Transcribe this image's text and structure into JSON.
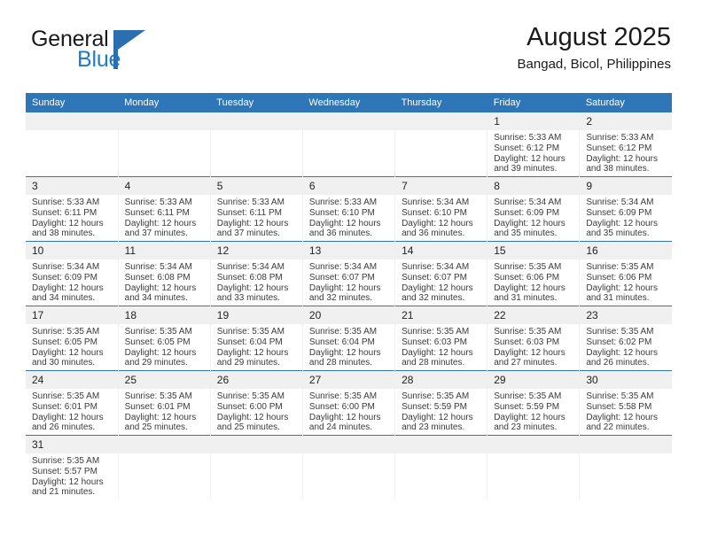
{
  "brand": {
    "word_one": "General",
    "word_two": "Blue",
    "mark_icon": "flag-triangle-icon"
  },
  "header": {
    "title": "August 2025",
    "subtitle": "Bangad, Bicol, Philippines"
  },
  "calendar": {
    "weekday_headers": [
      "Sunday",
      "Monday",
      "Tuesday",
      "Wednesday",
      "Thursday",
      "Friday",
      "Saturday"
    ],
    "accent_color": "#2e76b8",
    "daynum_band_color": "#f0f0f0",
    "weeks": [
      [
        {
          "day": "",
          "sunrise": "",
          "sunset": "",
          "daylight_line1": "",
          "daylight_line2": ""
        },
        {
          "day": "",
          "sunrise": "",
          "sunset": "",
          "daylight_line1": "",
          "daylight_line2": ""
        },
        {
          "day": "",
          "sunrise": "",
          "sunset": "",
          "daylight_line1": "",
          "daylight_line2": ""
        },
        {
          "day": "",
          "sunrise": "",
          "sunset": "",
          "daylight_line1": "",
          "daylight_line2": ""
        },
        {
          "day": "",
          "sunrise": "",
          "sunset": "",
          "daylight_line1": "",
          "daylight_line2": ""
        },
        {
          "day": "1",
          "sunrise": "Sunrise: 5:33 AM",
          "sunset": "Sunset: 6:12 PM",
          "daylight_line1": "Daylight: 12 hours",
          "daylight_line2": "and 39 minutes."
        },
        {
          "day": "2",
          "sunrise": "Sunrise: 5:33 AM",
          "sunset": "Sunset: 6:12 PM",
          "daylight_line1": "Daylight: 12 hours",
          "daylight_line2": "and 38 minutes."
        }
      ],
      [
        {
          "day": "3",
          "sunrise": "Sunrise: 5:33 AM",
          "sunset": "Sunset: 6:11 PM",
          "daylight_line1": "Daylight: 12 hours",
          "daylight_line2": "and 38 minutes."
        },
        {
          "day": "4",
          "sunrise": "Sunrise: 5:33 AM",
          "sunset": "Sunset: 6:11 PM",
          "daylight_line1": "Daylight: 12 hours",
          "daylight_line2": "and 37 minutes."
        },
        {
          "day": "5",
          "sunrise": "Sunrise: 5:33 AM",
          "sunset": "Sunset: 6:11 PM",
          "daylight_line1": "Daylight: 12 hours",
          "daylight_line2": "and 37 minutes."
        },
        {
          "day": "6",
          "sunrise": "Sunrise: 5:33 AM",
          "sunset": "Sunset: 6:10 PM",
          "daylight_line1": "Daylight: 12 hours",
          "daylight_line2": "and 36 minutes."
        },
        {
          "day": "7",
          "sunrise": "Sunrise: 5:34 AM",
          "sunset": "Sunset: 6:10 PM",
          "daylight_line1": "Daylight: 12 hours",
          "daylight_line2": "and 36 minutes."
        },
        {
          "day": "8",
          "sunrise": "Sunrise: 5:34 AM",
          "sunset": "Sunset: 6:09 PM",
          "daylight_line1": "Daylight: 12 hours",
          "daylight_line2": "and 35 minutes."
        },
        {
          "day": "9",
          "sunrise": "Sunrise: 5:34 AM",
          "sunset": "Sunset: 6:09 PM",
          "daylight_line1": "Daylight: 12 hours",
          "daylight_line2": "and 35 minutes."
        }
      ],
      [
        {
          "day": "10",
          "sunrise": "Sunrise: 5:34 AM",
          "sunset": "Sunset: 6:09 PM",
          "daylight_line1": "Daylight: 12 hours",
          "daylight_line2": "and 34 minutes."
        },
        {
          "day": "11",
          "sunrise": "Sunrise: 5:34 AM",
          "sunset": "Sunset: 6:08 PM",
          "daylight_line1": "Daylight: 12 hours",
          "daylight_line2": "and 34 minutes."
        },
        {
          "day": "12",
          "sunrise": "Sunrise: 5:34 AM",
          "sunset": "Sunset: 6:08 PM",
          "daylight_line1": "Daylight: 12 hours",
          "daylight_line2": "and 33 minutes."
        },
        {
          "day": "13",
          "sunrise": "Sunrise: 5:34 AM",
          "sunset": "Sunset: 6:07 PM",
          "daylight_line1": "Daylight: 12 hours",
          "daylight_line2": "and 32 minutes."
        },
        {
          "day": "14",
          "sunrise": "Sunrise: 5:34 AM",
          "sunset": "Sunset: 6:07 PM",
          "daylight_line1": "Daylight: 12 hours",
          "daylight_line2": "and 32 minutes."
        },
        {
          "day": "15",
          "sunrise": "Sunrise: 5:35 AM",
          "sunset": "Sunset: 6:06 PM",
          "daylight_line1": "Daylight: 12 hours",
          "daylight_line2": "and 31 minutes."
        },
        {
          "day": "16",
          "sunrise": "Sunrise: 5:35 AM",
          "sunset": "Sunset: 6:06 PM",
          "daylight_line1": "Daylight: 12 hours",
          "daylight_line2": "and 31 minutes."
        }
      ],
      [
        {
          "day": "17",
          "sunrise": "Sunrise: 5:35 AM",
          "sunset": "Sunset: 6:05 PM",
          "daylight_line1": "Daylight: 12 hours",
          "daylight_line2": "and 30 minutes."
        },
        {
          "day": "18",
          "sunrise": "Sunrise: 5:35 AM",
          "sunset": "Sunset: 6:05 PM",
          "daylight_line1": "Daylight: 12 hours",
          "daylight_line2": "and 29 minutes."
        },
        {
          "day": "19",
          "sunrise": "Sunrise: 5:35 AM",
          "sunset": "Sunset: 6:04 PM",
          "daylight_line1": "Daylight: 12 hours",
          "daylight_line2": "and 29 minutes."
        },
        {
          "day": "20",
          "sunrise": "Sunrise: 5:35 AM",
          "sunset": "Sunset: 6:04 PM",
          "daylight_line1": "Daylight: 12 hours",
          "daylight_line2": "and 28 minutes."
        },
        {
          "day": "21",
          "sunrise": "Sunrise: 5:35 AM",
          "sunset": "Sunset: 6:03 PM",
          "daylight_line1": "Daylight: 12 hours",
          "daylight_line2": "and 28 minutes."
        },
        {
          "day": "22",
          "sunrise": "Sunrise: 5:35 AM",
          "sunset": "Sunset: 6:03 PM",
          "daylight_line1": "Daylight: 12 hours",
          "daylight_line2": "and 27 minutes."
        },
        {
          "day": "23",
          "sunrise": "Sunrise: 5:35 AM",
          "sunset": "Sunset: 6:02 PM",
          "daylight_line1": "Daylight: 12 hours",
          "daylight_line2": "and 26 minutes."
        }
      ],
      [
        {
          "day": "24",
          "sunrise": "Sunrise: 5:35 AM",
          "sunset": "Sunset: 6:01 PM",
          "daylight_line1": "Daylight: 12 hours",
          "daylight_line2": "and 26 minutes."
        },
        {
          "day": "25",
          "sunrise": "Sunrise: 5:35 AM",
          "sunset": "Sunset: 6:01 PM",
          "daylight_line1": "Daylight: 12 hours",
          "daylight_line2": "and 25 minutes."
        },
        {
          "day": "26",
          "sunrise": "Sunrise: 5:35 AM",
          "sunset": "Sunset: 6:00 PM",
          "daylight_line1": "Daylight: 12 hours",
          "daylight_line2": "and 25 minutes."
        },
        {
          "day": "27",
          "sunrise": "Sunrise: 5:35 AM",
          "sunset": "Sunset: 6:00 PM",
          "daylight_line1": "Daylight: 12 hours",
          "daylight_line2": "and 24 minutes."
        },
        {
          "day": "28",
          "sunrise": "Sunrise: 5:35 AM",
          "sunset": "Sunset: 5:59 PM",
          "daylight_line1": "Daylight: 12 hours",
          "daylight_line2": "and 23 minutes."
        },
        {
          "day": "29",
          "sunrise": "Sunrise: 5:35 AM",
          "sunset": "Sunset: 5:59 PM",
          "daylight_line1": "Daylight: 12 hours",
          "daylight_line2": "and 23 minutes."
        },
        {
          "day": "30",
          "sunrise": "Sunrise: 5:35 AM",
          "sunset": "Sunset: 5:58 PM",
          "daylight_line1": "Daylight: 12 hours",
          "daylight_line2": "and 22 minutes."
        }
      ],
      [
        {
          "day": "31",
          "sunrise": "Sunrise: 5:35 AM",
          "sunset": "Sunset: 5:57 PM",
          "daylight_line1": "Daylight: 12 hours",
          "daylight_line2": "and 21 minutes."
        },
        {
          "day": "",
          "sunrise": "",
          "sunset": "",
          "daylight_line1": "",
          "daylight_line2": ""
        },
        {
          "day": "",
          "sunrise": "",
          "sunset": "",
          "daylight_line1": "",
          "daylight_line2": ""
        },
        {
          "day": "",
          "sunrise": "",
          "sunset": "",
          "daylight_line1": "",
          "daylight_line2": ""
        },
        {
          "day": "",
          "sunrise": "",
          "sunset": "",
          "daylight_line1": "",
          "daylight_line2": ""
        },
        {
          "day": "",
          "sunrise": "",
          "sunset": "",
          "daylight_line1": "",
          "daylight_line2": ""
        },
        {
          "day": "",
          "sunrise": "",
          "sunset": "",
          "daylight_line1": "",
          "daylight_line2": ""
        }
      ]
    ]
  }
}
